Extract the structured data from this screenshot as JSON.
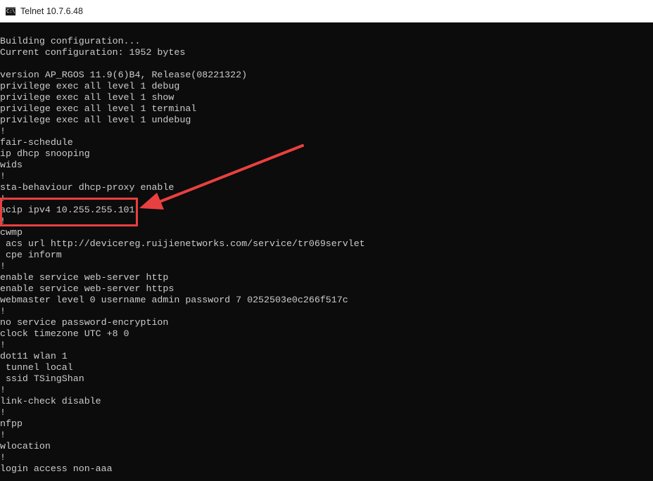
{
  "window": {
    "title": "Telnet 10.7.6.48",
    "icon": "console-icon",
    "icon_text": "C:\\"
  },
  "terminal": {
    "lines": [
      "Building configuration...",
      "Current configuration: 1952 bytes",
      "",
      "version AP_RGOS 11.9(6)B4, Release(08221322)",
      "privilege exec all level 1 debug",
      "privilege exec all level 1 show",
      "privilege exec all level 1 terminal",
      "privilege exec all level 1 undebug",
      "!",
      "fair-schedule",
      "ip dhcp snooping",
      "wids",
      "!",
      "sta-behaviour dhcp-proxy enable",
      "!",
      "acip ipv4 10.255.255.101",
      "!",
      "cwmp",
      " acs url http://devicereg.ruijienetworks.com/service/tr069servlet",
      " cpe inform",
      "!",
      "enable service web-server http",
      "enable service web-server https",
      "webmaster level 0 username admin password 7 0252503e0c266f517c",
      "!",
      "no service password-encryption",
      "clock timezone UTC +8 0",
      "!",
      "dot11 wlan 1",
      " tunnel local",
      " ssid TSingShan",
      "!",
      "link-check disable",
      "!",
      "nfpp",
      "!",
      "wlocation",
      "!",
      "login access non-aaa"
    ]
  },
  "annotation": {
    "highlighted_line": 15,
    "color": "#e8403f"
  },
  "colors": {
    "background": "#0c0c0c",
    "text": "#cccccc",
    "titlebar": "#ffffff"
  }
}
